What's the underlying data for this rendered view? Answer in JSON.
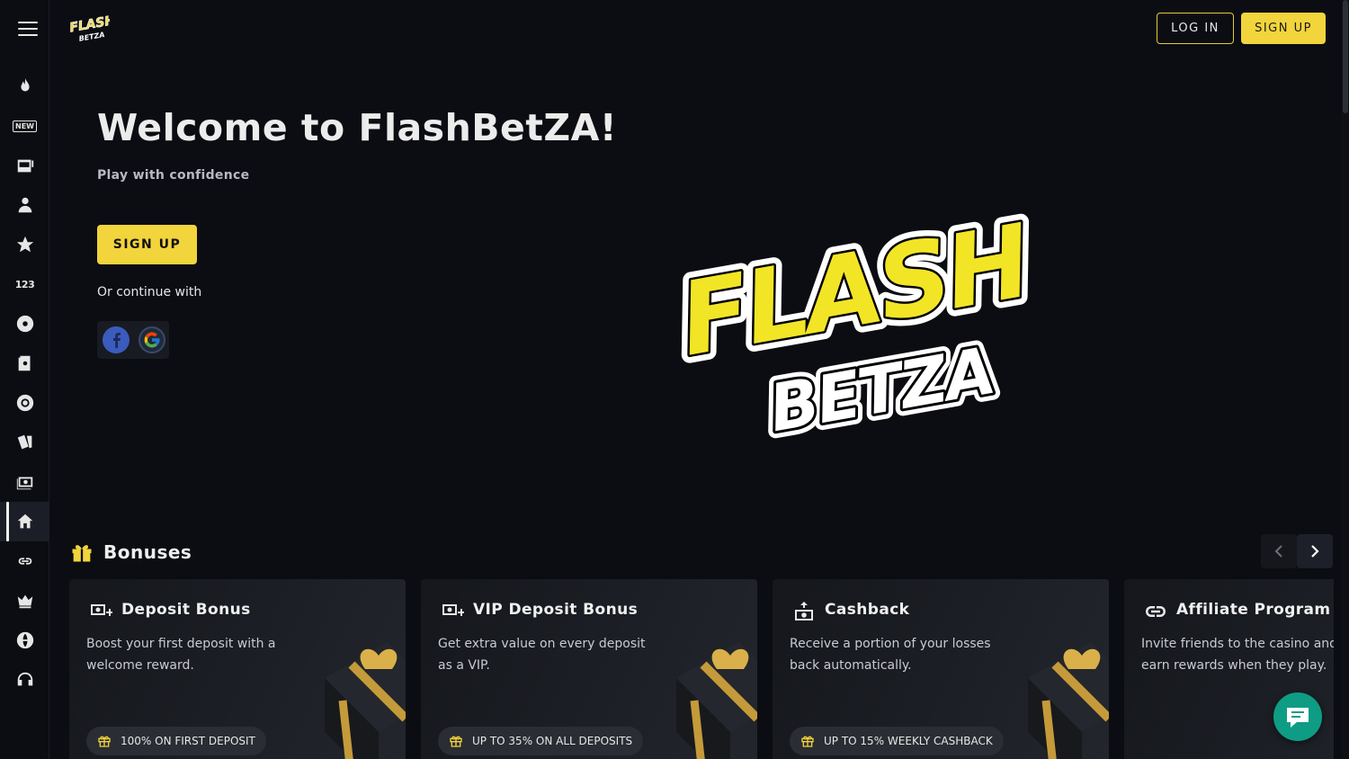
{
  "header": {
    "logo_text_top": "FLASH",
    "logo_text_bottom": "BETZA",
    "login_label": "LOG IN",
    "signup_label": "SIGN UP"
  },
  "sidebar": {
    "items": [
      {
        "icon": "fire-icon"
      },
      {
        "icon": "new-icon",
        "text": "NEW"
      },
      {
        "icon": "slot-machine-icon"
      },
      {
        "icon": "live-dealer-icon"
      },
      {
        "icon": "star-icon"
      },
      {
        "icon": "numbers-icon",
        "text": "123"
      },
      {
        "icon": "disc-icon"
      },
      {
        "icon": "cards-book-icon"
      },
      {
        "icon": "poker-chip-icon"
      },
      {
        "icon": "playing-cards-icon"
      },
      {
        "icon": "cash-icon"
      },
      {
        "icon": "home-icon",
        "active": true
      },
      {
        "icon": "link-icon"
      },
      {
        "icon": "crown-icon"
      },
      {
        "icon": "globe-icon"
      },
      {
        "icon": "headset-icon"
      }
    ]
  },
  "hero": {
    "title": "Welcome to FlashBetZA!",
    "subtitle": "Play with confidence",
    "signup_label": "SIGN UP",
    "or_continue": "Or continue with",
    "big_logo_top": "FLASH",
    "big_logo_bottom": "BETZA"
  },
  "bonuses": {
    "title": "Bonuses",
    "cards": [
      {
        "title": "Deposit Bonus",
        "description": "Boost your first deposit with a welcome reward.",
        "pill": "100% ON FIRST DEPOSIT",
        "icon": "deposit-icon"
      },
      {
        "title": "VIP Deposit Bonus",
        "description": "Get extra value on every deposit as a VIP.",
        "pill": "UP TO 35% ON ALL DEPOSITS",
        "icon": "deposit-icon"
      },
      {
        "title": "Cashback",
        "description": "Receive a portion of your losses back automatically.",
        "pill": "UP TO 15% WEEKLY CASHBACK",
        "icon": "cashback-icon"
      },
      {
        "title": "Affiliate Program",
        "description": "Invite friends to the casino and earn rewards when they play.",
        "pill": "",
        "icon": "link-icon"
      }
    ]
  },
  "colors": {
    "accent": "#f2d43c",
    "background": "#0b0d12",
    "chat": "#0f9c84"
  }
}
